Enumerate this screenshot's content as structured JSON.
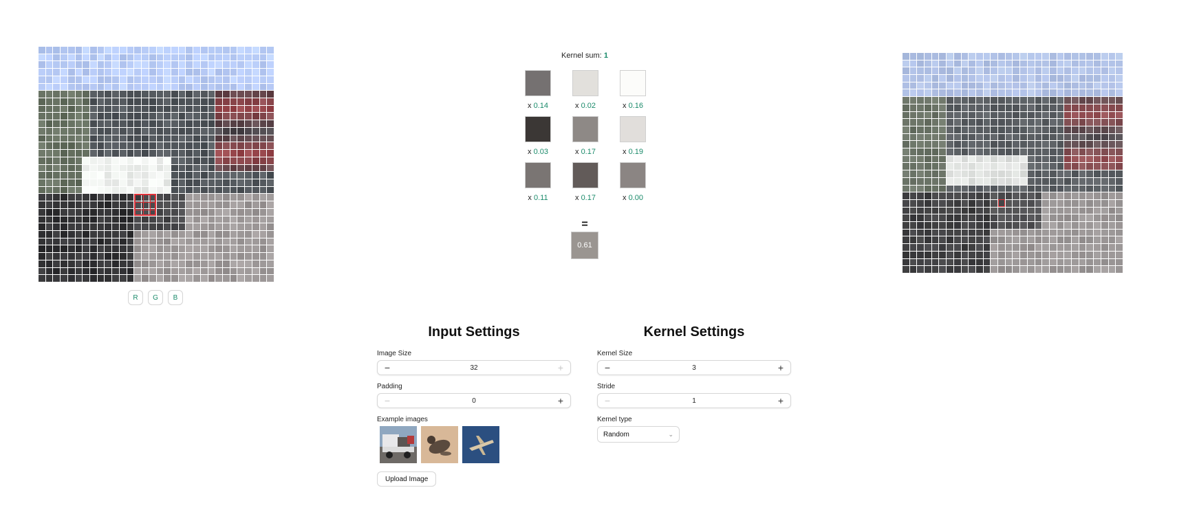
{
  "input_image": {
    "size": 32,
    "highlight": {
      "row": 20,
      "col": 13,
      "size": 3
    },
    "channel_buttons": [
      "R",
      "G",
      "B"
    ]
  },
  "output_image": {
    "size": 30,
    "highlight": {
      "row": 20,
      "col": 13
    }
  },
  "kernel": {
    "sum_label": "Kernel sum:",
    "sum_value": "1",
    "cells": [
      {
        "prefix": "x",
        "weight": "0.14",
        "color": "#757171"
      },
      {
        "prefix": "x",
        "weight": "0.02",
        "color": "#e2e0dc"
      },
      {
        "prefix": "x",
        "weight": "0.16",
        "color": "#fcfcfa"
      },
      {
        "prefix": "x",
        "weight": "0.03",
        "color": "#3b3735"
      },
      {
        "prefix": "x",
        "weight": "0.17",
        "color": "#8e8986"
      },
      {
        "prefix": "x",
        "weight": "0.19",
        "color": "#e1dedb"
      },
      {
        "prefix": "x",
        "weight": "0.11",
        "color": "#7a7573"
      },
      {
        "prefix": "x",
        "weight": "0.17",
        "color": "#625b59"
      },
      {
        "prefix": "x",
        "weight": "0.00",
        "color": "#8b8583"
      }
    ],
    "equals": "=",
    "result": "0.61"
  },
  "input_settings": {
    "title": "Input Settings",
    "image_size": {
      "label": "Image Size",
      "value": "32",
      "minus": "−",
      "plus": "+"
    },
    "padding": {
      "label": "Padding",
      "value": "0",
      "minus": "−",
      "plus": "+"
    },
    "examples_label": "Example images",
    "examples": [
      "truck",
      "cat",
      "airplane"
    ],
    "upload_label": "Upload Image"
  },
  "kernel_settings": {
    "title": "Kernel Settings",
    "kernel_size": {
      "label": "Kernel Size",
      "value": "3",
      "minus": "−",
      "plus": "+"
    },
    "stride": {
      "label": "Stride",
      "value": "1",
      "minus": "−",
      "plus": "+"
    },
    "type_label": "Kernel type",
    "type_value": "Random"
  },
  "colors": {
    "accent": "#1a8a6a",
    "highlight": "#e0343b"
  }
}
